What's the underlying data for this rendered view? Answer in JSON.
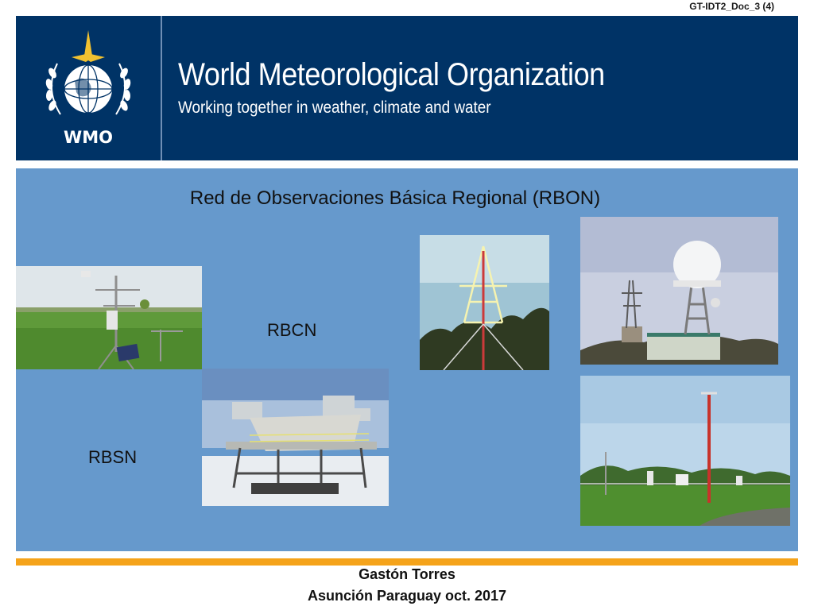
{
  "document_code": "GT-IDT2_Doc_3 (4)",
  "header": {
    "logo_text": "WMO",
    "title": "World Meteorological Organization",
    "subtitle": "Working together in weather, climate and water"
  },
  "slide": {
    "heading": "Red de Observaciones Básica Regional (RBON)",
    "labels": {
      "rbcn": "RBCN",
      "rbsn": "RBSN"
    },
    "photos": [
      "automatic-weather-station-photo",
      "antarctic-station-photo",
      "antenna-mast-photo",
      "weather-radar-photo",
      "observation-field-photo"
    ]
  },
  "footer": {
    "author": "Gastón Torres",
    "place_date": "Asunción Paraguay oct. 2017"
  },
  "colors": {
    "header": "#003366",
    "panel": "#6699cc",
    "accent": "#f5a31a"
  }
}
